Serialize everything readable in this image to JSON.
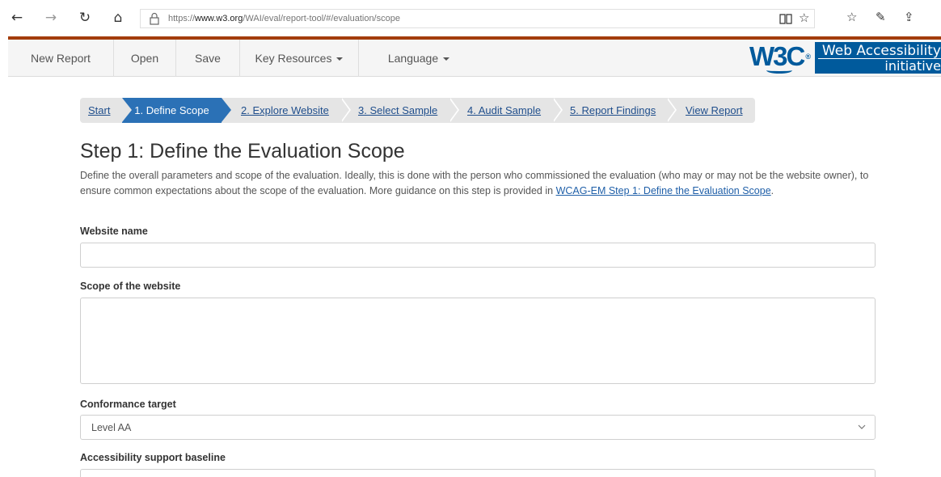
{
  "browser": {
    "url_prefix": "https://",
    "url_domain": "www.w3.org",
    "url_path": "/WAI/eval/report-tool/#/evaluation/scope"
  },
  "header": {
    "menu": [
      {
        "label": "New Report"
      },
      {
        "label": "Open"
      },
      {
        "label": "Save"
      },
      {
        "label": "Key Resources"
      },
      {
        "label": "Language"
      }
    ],
    "logo_text": "W3C",
    "logo_reg": "®",
    "wai_line1": "Web Accessibility",
    "wai_line2": "initiative"
  },
  "steps": [
    {
      "label": "Start"
    },
    {
      "label": "1. Define Scope",
      "active": true
    },
    {
      "label": "2. Explore Website"
    },
    {
      "label": "3. Select Sample"
    },
    {
      "label": "4. Audit Sample"
    },
    {
      "label": "5. Report Findings"
    },
    {
      "label": "View Report"
    }
  ],
  "main": {
    "title": "Step 1: Define the Evaluation Scope",
    "intro": "Define the overall parameters and scope of the evaluation. Ideally, this is done with the person who commissioned the evaluation (who may or may not be the website owner), to ensure common expectations about the scope of the evaluation. More guidance on this step is provided in ",
    "intro_link": "WCAG-EM Step 1: Define the Evaluation Scope",
    "intro_end": "."
  },
  "form": {
    "website_name_label": "Website name",
    "website_name_value": "",
    "scope_label": "Scope of the website",
    "scope_value": "",
    "conformance_label": "Conformance target",
    "conformance_value": "Level AA",
    "support_label": "Accessibility support baseline"
  },
  "colors": {
    "accent": "#2b71b6",
    "w3c_blue": "#005a9c",
    "top_rule": "#a33c0b"
  }
}
